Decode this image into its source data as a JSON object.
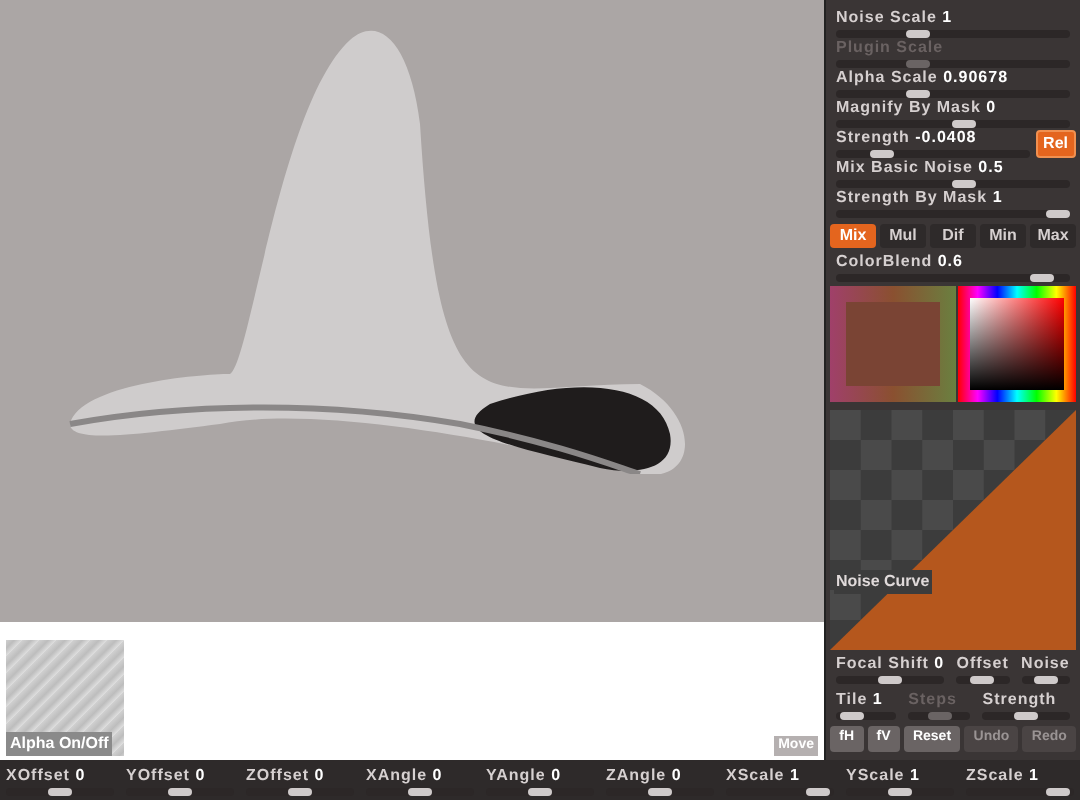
{
  "viewport": {
    "alpha_label": "Alpha On/Off",
    "move_button": "Move"
  },
  "panel": {
    "rows": [
      {
        "label": "Noise Scale",
        "value": "1",
        "disabled": false,
        "level": 0.33
      },
      {
        "label": "Plugin Scale",
        "disabled": true,
        "level": 0.33
      },
      {
        "label": "Alpha Scale",
        "value": "0.90678",
        "disabled": false,
        "level": 0.33
      },
      {
        "label": "Magnify By Mask",
        "value": "0",
        "disabled": false,
        "level": 0.55
      },
      {
        "label": "Strength",
        "value": "-0.0408",
        "disabled": false,
        "level": 0.2,
        "button": {
          "label": "Rel",
          "on": true
        }
      },
      {
        "label": "Mix Basic Noise",
        "value": "0.5",
        "disabled": false,
        "level": 0.55
      },
      {
        "label": "Strength By Mask",
        "value": "1",
        "disabled": false,
        "level": 1
      }
    ],
    "blend_modes": [
      {
        "label": "Mix",
        "selected": true
      },
      {
        "label": "Mul",
        "selected": false
      },
      {
        "label": "Dif",
        "selected": false
      },
      {
        "label": "Min",
        "selected": false
      },
      {
        "label": "Max",
        "selected": false
      }
    ],
    "color_blend": {
      "label": "ColorBlend",
      "value": "0.6",
      "level": 0.92
    },
    "noise_curve": {
      "label": "Noise Curve"
    },
    "curve_settings": [
      [
        {
          "label": "Focal Shift",
          "value": "0",
          "disabled": false,
          "level": 0.5
        },
        {
          "label": "Offset",
          "disabled": false,
          "level": 0.5
        },
        {
          "label": "Noise",
          "disabled": false,
          "level": 0.5
        }
      ],
      [
        {
          "label": "Tile",
          "value": "1",
          "disabled": false,
          "level": 0.1
        },
        {
          "label": "Steps",
          "disabled": true,
          "level": 0.5
        },
        {
          "label": "Strength",
          "disabled": false,
          "level": 0.5
        }
      ]
    ],
    "curve_buttons": [
      {
        "label": "fH",
        "disabled": false
      },
      {
        "label": "fV",
        "disabled": false
      },
      {
        "label": "Reset",
        "disabled": false
      },
      {
        "label": "Undo",
        "disabled": true
      },
      {
        "label": "Redo",
        "disabled": true
      }
    ]
  },
  "bottom_bar": [
    {
      "label": "XOffset",
      "value": "0",
      "level": 0.5
    },
    {
      "label": "YOffset",
      "value": "0",
      "level": 0.5
    },
    {
      "label": "ZOffset",
      "value": "0",
      "level": 0.5
    },
    {
      "label": "XAngle",
      "value": "0",
      "level": 0.5
    },
    {
      "label": "YAngle",
      "value": "0",
      "level": 0.5
    },
    {
      "label": "ZAngle",
      "value": "0",
      "level": 0.5
    },
    {
      "label": "XScale",
      "value": "1",
      "level": 0.95
    },
    {
      "label": "YScale",
      "value": "1",
      "level": 0.5
    },
    {
      "label": "ZScale",
      "value": "1",
      "level": 0.95
    }
  ]
}
